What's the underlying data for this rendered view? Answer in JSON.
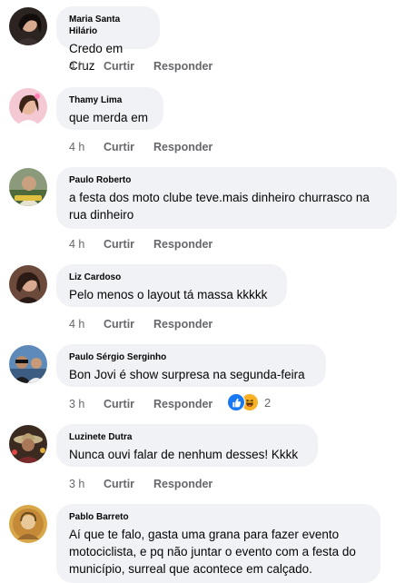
{
  "comments": [
    {
      "author": "Maria Santa Hilário",
      "text": "Credo em Cruz",
      "time": "4 h",
      "like": "Curtir",
      "reply": "Responder"
    },
    {
      "author": "Thamy Lima",
      "text": "que merda em",
      "time": "4 h",
      "like": "Curtir",
      "reply": "Responder"
    },
    {
      "author": "Paulo Roberto",
      "text": "a festa dos moto clube teve.mais dinheiro churrasco na rua dinheiro",
      "time": "4 h",
      "like": "Curtir",
      "reply": "Responder"
    },
    {
      "author": "Liz Cardoso",
      "text": "Pelo menos o layout tá massa kkkkk",
      "time": "4 h",
      "like": "Curtir",
      "reply": "Responder"
    },
    {
      "author": "Paulo Sérgio Serginho",
      "text": "Bon Jovi é show surpresa na segunda-feira",
      "time": "3 h",
      "like": "Curtir",
      "reply": "Responder",
      "reaction_count": "2"
    },
    {
      "author": "Luzinete Dutra",
      "text": "Nunca ouvi falar de nenhum desses! Kkkk",
      "time": "3 h",
      "like": "Curtir",
      "reply": "Responder"
    },
    {
      "author": "Pablo Barreto",
      "text": "Aí que te falo, gasta uma grana para fazer evento motociclista, e pq não juntar o evento com a festa do município, surreal que acontece em calçado."
    }
  ],
  "icons": {
    "reaction_like": "like-icon",
    "reaction_haha": "haha-icon"
  },
  "colors": {
    "bubble": "#f0f2f5",
    "action_text": "#65676b",
    "like_blue": "#1877f2",
    "haha_yellow": "#f7b125"
  }
}
